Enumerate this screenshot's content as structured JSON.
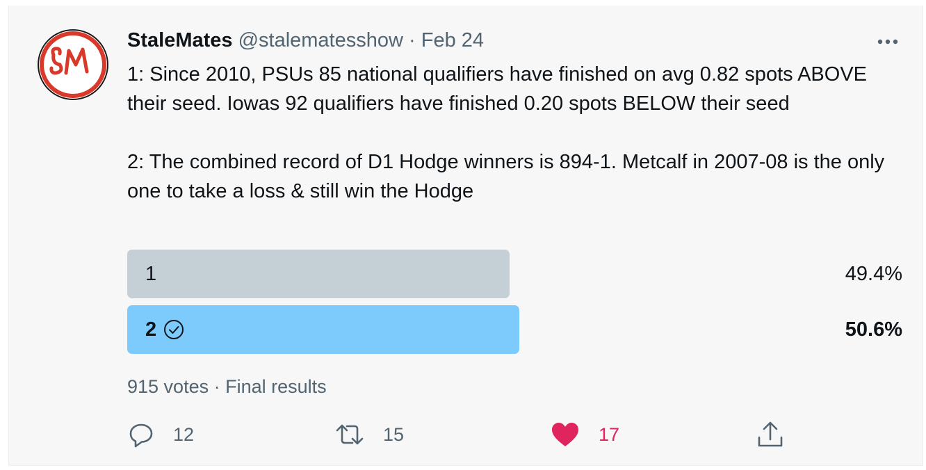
{
  "tweet": {
    "display_name": "StaleMates",
    "handle": "@stalematesshow",
    "separator": "·",
    "date": "Feb 24",
    "avatar_text": "SM",
    "body_paragraphs": [
      "1: Since 2010, PSUs 85 national qualifiers have finished on avg 0.82 spots ABOVE their seed. Iowas 92 qualifiers have finished 0.20 spots BELOW their seed",
      "2: The combined record of D1 Hodge winners is 894-1. Metcalf in 2007-08 is the only one to take a loss & still win the Hodge"
    ]
  },
  "poll": {
    "options": [
      {
        "label": "1",
        "percent_text": "49.4%",
        "percent": 49.4,
        "winner": false,
        "color": "#c4cfd6"
      },
      {
        "label": "2",
        "percent_text": "50.6%",
        "percent": 50.6,
        "winner": true,
        "color": "#7ccbfc",
        "icon": "check-circle-icon"
      }
    ],
    "votes": "915 votes",
    "separator": "·",
    "status": "Final results"
  },
  "actions": {
    "reply": {
      "icon": "reply-icon",
      "count": "12"
    },
    "retweet": {
      "icon": "retweet-icon",
      "count": "15"
    },
    "like": {
      "icon": "heart-icon",
      "count": "17",
      "color": "#e0245e"
    },
    "share": {
      "icon": "share-icon"
    }
  },
  "more_icon": "more-icon"
}
